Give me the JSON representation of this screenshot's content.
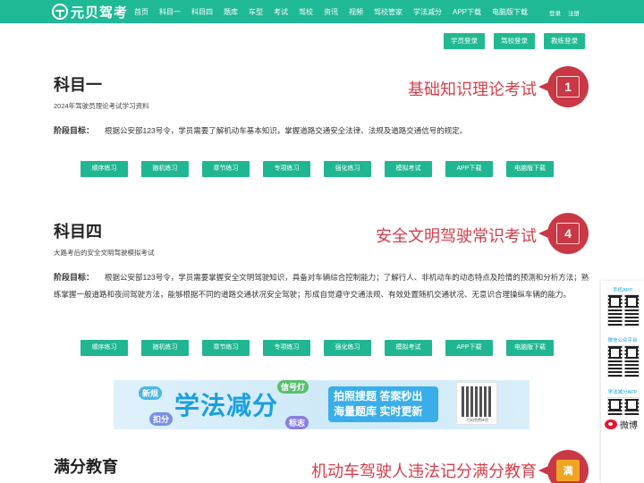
{
  "header": {
    "logo_text": "元贝驾考",
    "nav": [
      "首页",
      "科目一",
      "科目四",
      "题库",
      "车型",
      "考试",
      "驾校",
      "资讯",
      "视频",
      "驾校管家",
      "学法减分",
      "APP下载",
      "电脑版下载"
    ],
    "login": "登录",
    "register": "注册"
  },
  "login_buttons": [
    "学员登录",
    "驾校登录",
    "教练登录"
  ],
  "sections": [
    {
      "title": "科目一",
      "subtitle": "2024年驾驶员理论考试学习资料",
      "goal_label": "阶段目标：",
      "goal_text": "根据公安部123号令，学员需要了解机动车基本知识，掌握道路交通安全法律、法规及道路交通信号的规定。",
      "slogan": "基础知识理论考试",
      "badge_icon": "monitor-1-icon",
      "badge_glyph": "1",
      "buttons": [
        "顺序练习",
        "随机练习",
        "章节练习",
        "专项练习",
        "强化练习",
        "模拟考试",
        "APP下载",
        "电脑版下载"
      ]
    },
    {
      "title": "科目四",
      "subtitle": "大路考后的安全文明驾驶模拟考试",
      "goal_label": "阶段目标：",
      "goal_text": "根据公安部123号令，学员需要掌握安全文明驾驶知识，具备对车辆综合控制能力；了解行人、非机动车的动态特点及险情的预测和分析方法；熟练掌握一般道路和夜间驾驶方法，能够根据不同的道路交通状况安全驾驶；形成自觉遵守交通法规、有效处置随机交通状况、无意识合理操纵车辆的能力。",
      "slogan": "安全文明驾驶常识考试",
      "badge_icon": "book-4-icon",
      "badge_glyph": "4",
      "buttons": [
        "顺序练习",
        "随机练习",
        "章节练习",
        "专项练习",
        "强化练习",
        "模拟考试",
        "APP下载",
        "电脑版下载"
      ]
    },
    {
      "title": "满分教育",
      "slogan": "机动车驾驶人违法记分满分教育",
      "badge_icon": "manfen-icon",
      "badge_glyph": "满"
    }
  ],
  "banner": {
    "tags": [
      "新规",
      "信号灯",
      "扣分",
      "标志"
    ],
    "headline": "学法减分",
    "panel_line1": "拍照搜题 答案秒出",
    "panel_line2": "海量题库 实时更新",
    "qr_caption": "扫码免费体验"
  },
  "float_panel": {
    "captions": [
      "手机APP",
      "微信公众平台",
      "学法减分APP"
    ],
    "weibo": "微博"
  },
  "colors": {
    "brand_green": "#1fb996",
    "slogan_red": "#d23f4c",
    "badge_red": "#c93844"
  }
}
